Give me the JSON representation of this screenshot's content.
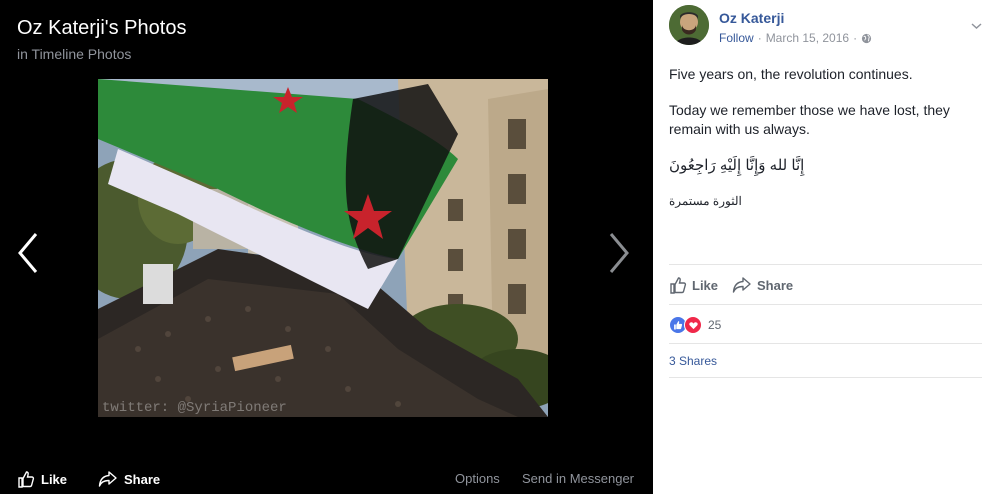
{
  "viewer": {
    "title": "Oz Katerji's Photos",
    "subtitle": "in Timeline Photos",
    "watermark": "twitter: @SyriaPioneer",
    "actions": {
      "like": "Like",
      "share": "Share",
      "options": "Options",
      "send": "Send in Messenger"
    },
    "icons": {
      "prev": "chevron-left-icon",
      "next": "chevron-right-icon",
      "like": "thumbs-up-icon",
      "share": "share-arrow-icon"
    }
  },
  "post": {
    "author": "Oz Katerji",
    "follow": "Follow",
    "separator": "·",
    "date": "March 15, 2016",
    "privacy_icon": "globe-icon",
    "menu_icon": "chevron-down-icon",
    "text_line1": "Five years on, the revolution continues.",
    "text_line2": "Today we remember those we have lost, they remain with us always.",
    "arabic_line1": "إِنَّا لله وَإِنَّا إِلَيْهِ رَاجِعُونَ",
    "arabic_line2": "الثورة مستمرة",
    "actions": {
      "like": "Like",
      "share": "Share"
    },
    "reactions": {
      "count": "25",
      "types": [
        "like",
        "love"
      ]
    },
    "shares": "3 Shares"
  },
  "colors": {
    "link": "#365899",
    "like_blue": "#4a76e8",
    "love_red": "#f0284a",
    "viewer_bg": "#000000"
  }
}
